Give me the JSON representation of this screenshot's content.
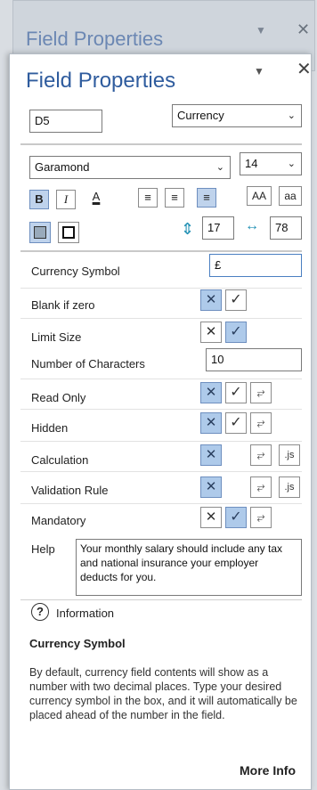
{
  "back_panel": {
    "title": "Field Properties"
  },
  "panel": {
    "title": "Field Properties"
  },
  "field_name": "D5",
  "field_type": "Currency",
  "font_name": "Garamond",
  "font_size": "14",
  "format_buttons": {
    "bold": "B",
    "italic": "I",
    "text_color": "A",
    "uppercase": "AA",
    "lowercase": "aa"
  },
  "height_value": "17",
  "width_value": "78",
  "properties": {
    "currency_symbol_label": "Currency Symbol",
    "currency_symbol_value": "£",
    "blank_if_zero_label": "Blank if zero",
    "limit_size_label": "Limit Size",
    "number_of_characters_label": "Number of Characters",
    "number_of_characters_value": "10",
    "read_only_label": "Read Only",
    "hidden_label": "Hidden",
    "calculation_label": "Calculation",
    "validation_rule_label": "Validation Rule",
    "mandatory_label": "Mandatory",
    "help_label": "Help",
    "help_text": "Your monthly salary should include any tax and national insurance your employer deducts for you."
  },
  "glyphs": {
    "x": "✕",
    "check": "✓",
    "script": "⥂",
    "js": ".js"
  },
  "information": {
    "label": "Information",
    "heading": "Currency Symbol",
    "body": "By default, currency field contents will show as a number with two decimal places. Type your desired currency symbol in the box, and it will automatically be placed ahead of the number in the field.",
    "more_info": "More Info"
  },
  "colors": {
    "title_blue": "#2f5c9e",
    "active_blue": "#aecaea"
  }
}
